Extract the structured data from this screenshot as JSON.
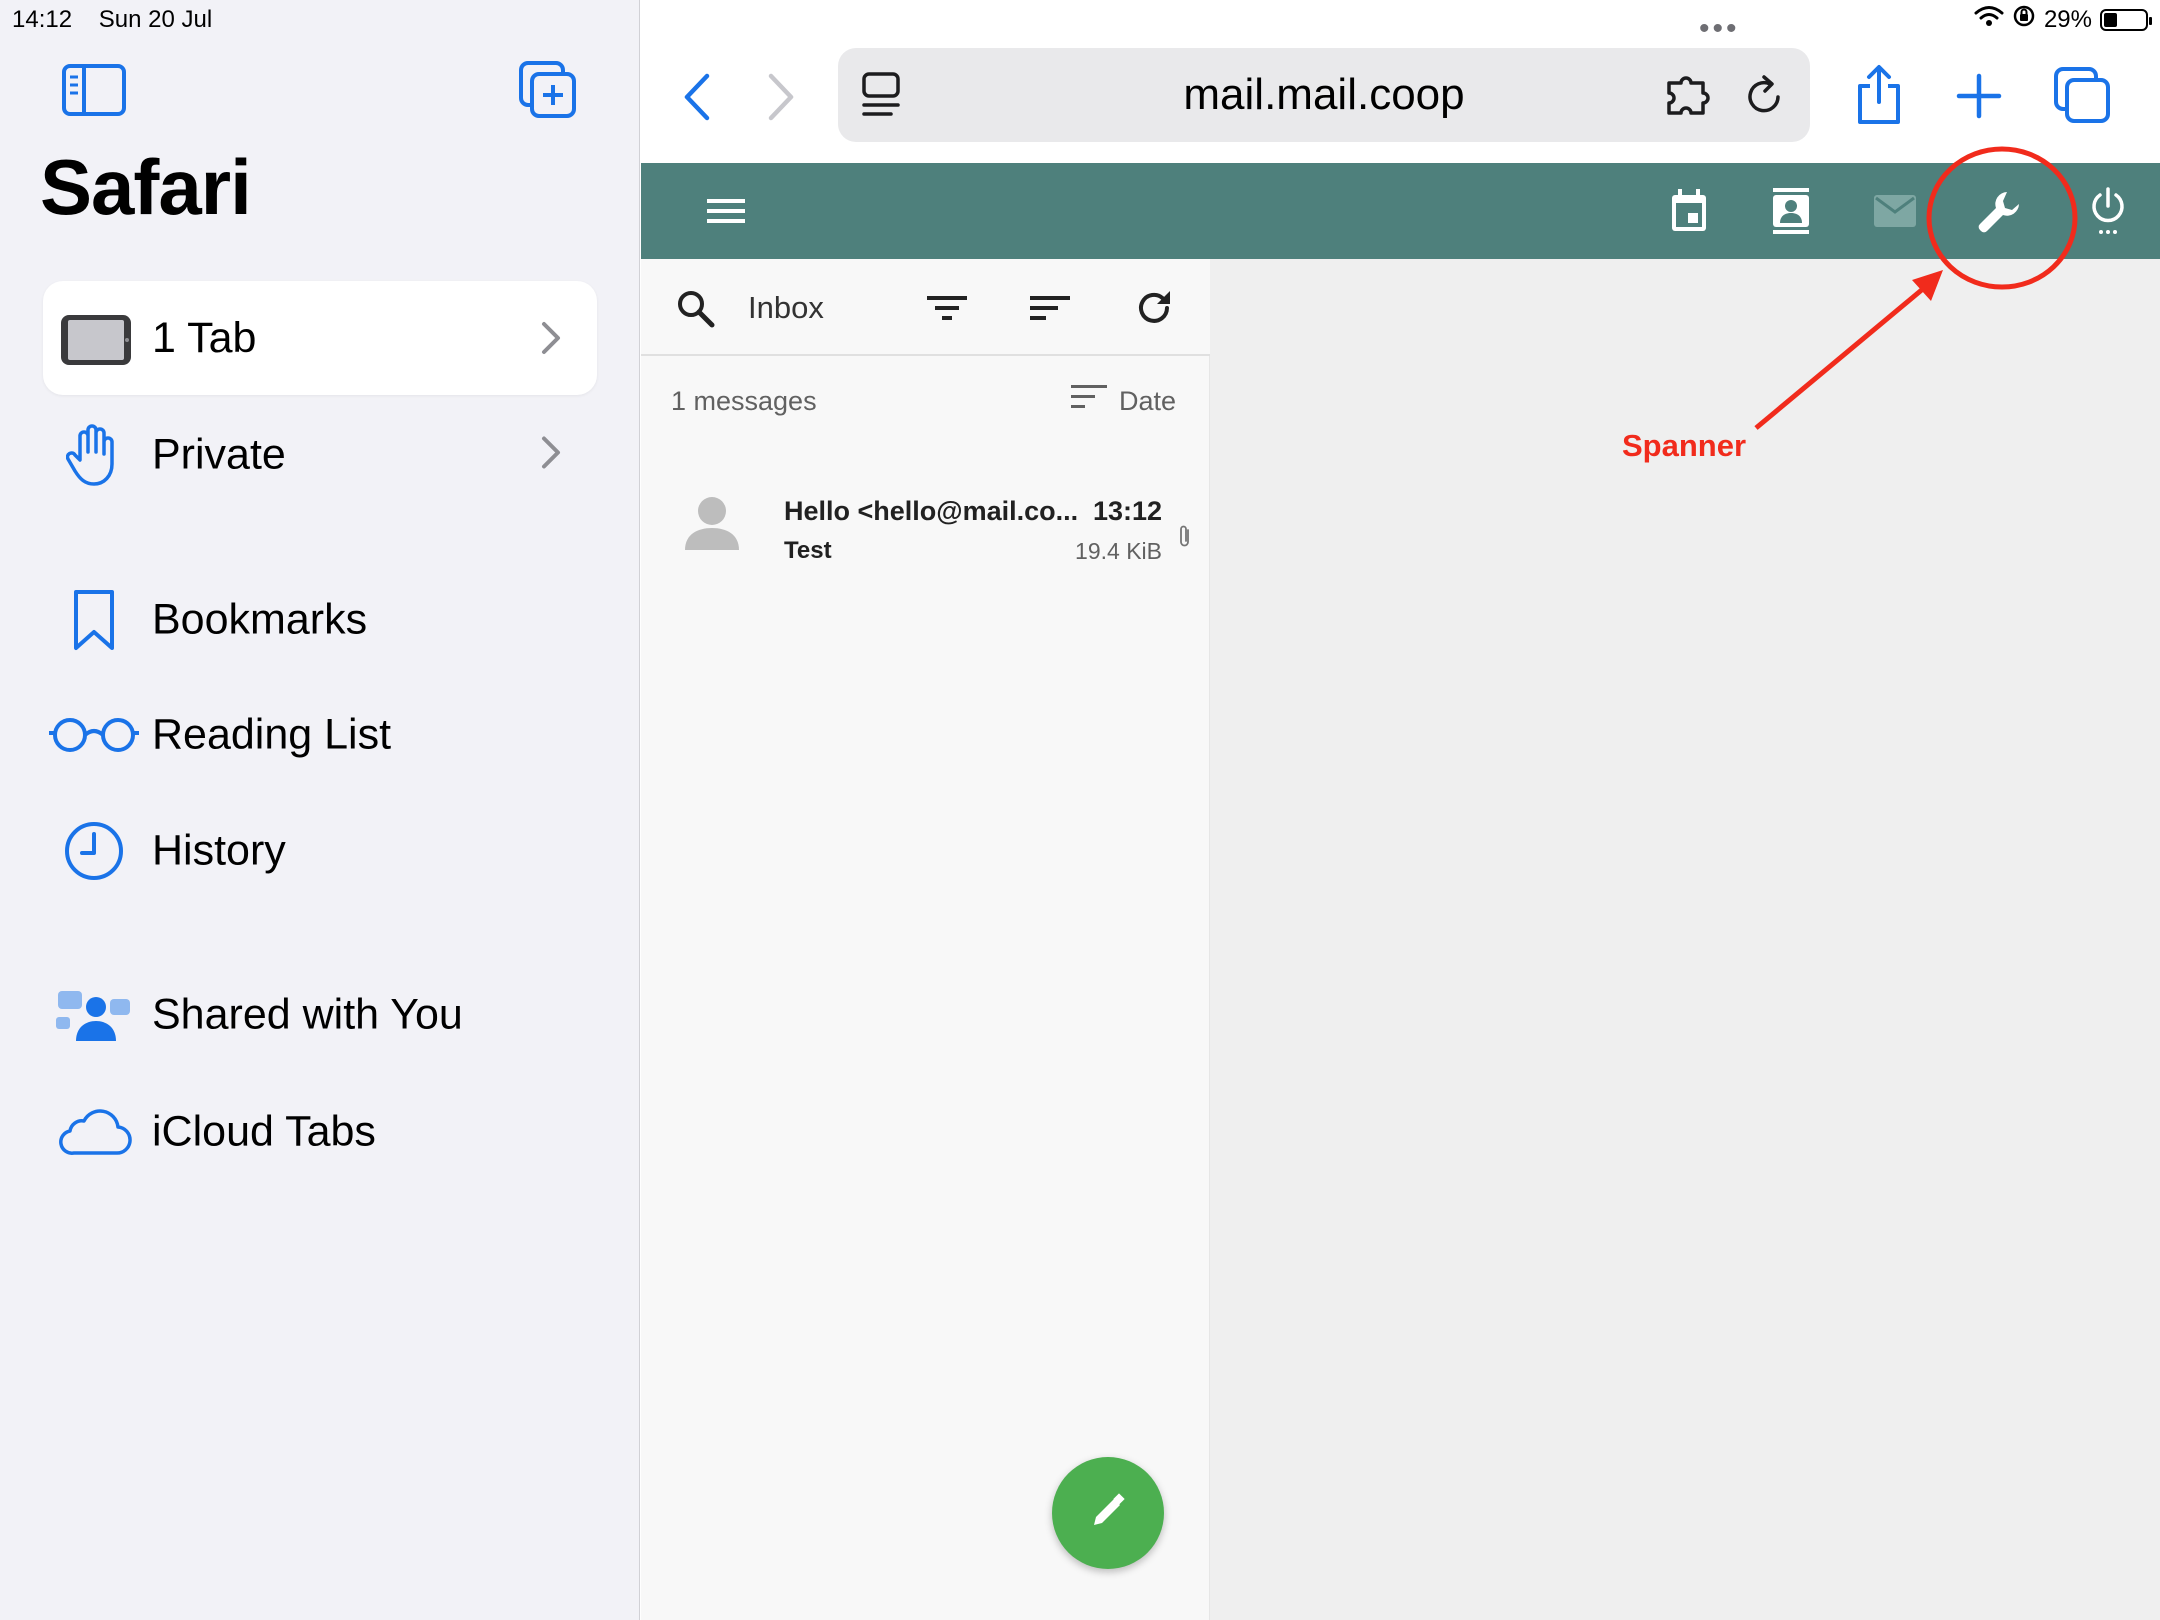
{
  "status": {
    "time": "14:12",
    "date": "Sun 20 Jul",
    "battery": "29%",
    "battery_level": 0.29
  },
  "sidebar": {
    "title": "Safari",
    "tab_group": {
      "label": "1 Tab",
      "icon": "ipad-icon"
    },
    "items": [
      {
        "label": "Private",
        "icon": "hand-icon"
      },
      {
        "label": "Bookmarks",
        "icon": "bookmark-icon"
      },
      {
        "label": "Reading List",
        "icon": "glasses-icon"
      },
      {
        "label": "History",
        "icon": "clock-icon"
      },
      {
        "label": "Shared with You",
        "icon": "shared-people-icon"
      },
      {
        "label": "iCloud Tabs",
        "icon": "cloud-icon"
      }
    ]
  },
  "browser": {
    "url": "mail.mail.coop",
    "accent": "#1a73e8"
  },
  "app": {
    "header_color": "#4e807c",
    "folder": "Inbox",
    "message_count": "1 messages",
    "sort_label": "Date",
    "messages": [
      {
        "from": "Hello <hello@mail.co...",
        "subject": "Test",
        "time": "13:12",
        "size": "19.4 KiB",
        "has_attachment": true
      }
    ],
    "compose_color": "#4caf50"
  },
  "annotation": {
    "label": "Spanner",
    "color": "#f12b1c"
  }
}
